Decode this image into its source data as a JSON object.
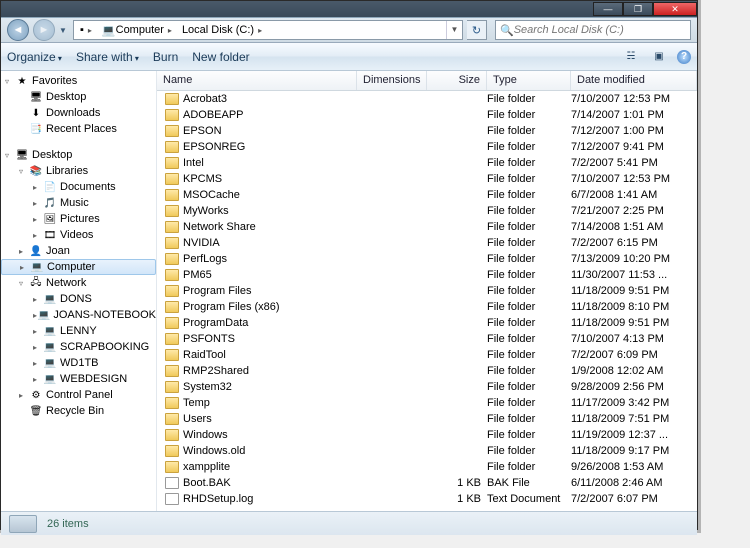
{
  "titlebar": {
    "min": "—",
    "max": "❐",
    "close": "✕"
  },
  "nav": {
    "back": "◄",
    "fwd": "►",
    "path": [
      {
        "icon": "💻",
        "label": "Computer"
      },
      {
        "icon": "",
        "label": "Local Disk (C:)"
      }
    ],
    "refresh": "↻"
  },
  "search": {
    "placeholder": "Search Local Disk (C:)"
  },
  "toolbar": {
    "organize": "Organize",
    "share": "Share with",
    "burn": "Burn",
    "newfolder": "New folder",
    "views": "☵",
    "preview": "▣",
    "help": "?"
  },
  "columns": {
    "name": "Name",
    "dim": "Dimensions",
    "size": "Size",
    "type": "Type",
    "date": "Date modified"
  },
  "tree": {
    "favorites": {
      "label": "Favorites",
      "icon": "★",
      "exp": "▿"
    },
    "fav_items": [
      {
        "label": "Desktop",
        "icon": "🖥"
      },
      {
        "label": "Downloads",
        "icon": "⬇"
      },
      {
        "label": "Recent Places",
        "icon": "📑"
      }
    ],
    "desktop": {
      "label": "Desktop",
      "icon": "🖥",
      "exp": "▿"
    },
    "libraries": {
      "label": "Libraries",
      "icon": "📚",
      "exp": "▿"
    },
    "lib_items": [
      {
        "label": "Documents",
        "icon": "📄"
      },
      {
        "label": "Music",
        "icon": "🎵"
      },
      {
        "label": "Pictures",
        "icon": "🖼"
      },
      {
        "label": "Videos",
        "icon": "🎞"
      }
    ],
    "joan": {
      "label": "Joan",
      "icon": "👤",
      "exp": "▸"
    },
    "computer": {
      "label": "Computer",
      "icon": "💻",
      "exp": "▸"
    },
    "network": {
      "label": "Network",
      "icon": "🖧",
      "exp": "▿"
    },
    "net_items": [
      {
        "label": "DONS",
        "icon": "💻"
      },
      {
        "label": "JOANS-NOTEBOOK",
        "icon": "💻"
      },
      {
        "label": "LENNY",
        "icon": "💻"
      },
      {
        "label": "SCRAPBOOKING",
        "icon": "💻"
      },
      {
        "label": "WD1TB",
        "icon": "💻"
      },
      {
        "label": "WEBDESIGN",
        "icon": "💻"
      }
    ],
    "cpanel": {
      "label": "Control Panel",
      "icon": "⚙",
      "exp": "▸"
    },
    "recycle": {
      "label": "Recycle Bin",
      "icon": "🗑",
      "exp": ""
    }
  },
  "files": [
    {
      "name": "Acrobat3",
      "size": "",
      "type": "File folder",
      "date": "7/10/2007 12:53 PM",
      "k": "folder"
    },
    {
      "name": "ADOBEAPP",
      "size": "",
      "type": "File folder",
      "date": "7/14/2007 1:01 PM",
      "k": "folder"
    },
    {
      "name": "EPSON",
      "size": "",
      "type": "File folder",
      "date": "7/12/2007 1:00 PM",
      "k": "folder"
    },
    {
      "name": "EPSONREG",
      "size": "",
      "type": "File folder",
      "date": "7/12/2007 9:41 PM",
      "k": "folder"
    },
    {
      "name": "Intel",
      "size": "",
      "type": "File folder",
      "date": "7/2/2007 5:41 PM",
      "k": "folder"
    },
    {
      "name": "KPCMS",
      "size": "",
      "type": "File folder",
      "date": "7/10/2007 12:53 PM",
      "k": "folder"
    },
    {
      "name": "MSOCache",
      "size": "",
      "type": "File folder",
      "date": "6/7/2008 1:41 AM",
      "k": "folder"
    },
    {
      "name": "MyWorks",
      "size": "",
      "type": "File folder",
      "date": "7/21/2007 2:25 PM",
      "k": "folder"
    },
    {
      "name": "Network Share",
      "size": "",
      "type": "File folder",
      "date": "7/14/2008 1:51 AM",
      "k": "folder"
    },
    {
      "name": "NVIDIA",
      "size": "",
      "type": "File folder",
      "date": "7/2/2007 6:15 PM",
      "k": "folder"
    },
    {
      "name": "PerfLogs",
      "size": "",
      "type": "File folder",
      "date": "7/13/2009 10:20 PM",
      "k": "folder"
    },
    {
      "name": "PM65",
      "size": "",
      "type": "File folder",
      "date": "11/30/2007 11:53 ...",
      "k": "folder"
    },
    {
      "name": "Program Files",
      "size": "",
      "type": "File folder",
      "date": "11/18/2009 9:51 PM",
      "k": "folder"
    },
    {
      "name": "Program Files (x86)",
      "size": "",
      "type": "File folder",
      "date": "11/18/2009 8:10 PM",
      "k": "folder"
    },
    {
      "name": "ProgramData",
      "size": "",
      "type": "File folder",
      "date": "11/18/2009 9:51 PM",
      "k": "folder"
    },
    {
      "name": "PSFONTS",
      "size": "",
      "type": "File folder",
      "date": "7/10/2007 4:13 PM",
      "k": "folder"
    },
    {
      "name": "RaidTool",
      "size": "",
      "type": "File folder",
      "date": "7/2/2007 6:09 PM",
      "k": "folder"
    },
    {
      "name": "RMP2Shared",
      "size": "",
      "type": "File folder",
      "date": "1/9/2008 12:02 AM",
      "k": "folder"
    },
    {
      "name": "System32",
      "size": "",
      "type": "File folder",
      "date": "9/28/2009 2:56 PM",
      "k": "folder"
    },
    {
      "name": "Temp",
      "size": "",
      "type": "File folder",
      "date": "11/17/2009 3:42 PM",
      "k": "folder"
    },
    {
      "name": "Users",
      "size": "",
      "type": "File folder",
      "date": "11/18/2009 7:51 PM",
      "k": "folder"
    },
    {
      "name": "Windows",
      "size": "",
      "type": "File folder",
      "date": "11/19/2009 12:37 ...",
      "k": "folder"
    },
    {
      "name": "Windows.old",
      "size": "",
      "type": "File folder",
      "date": "11/18/2009 9:17 PM",
      "k": "folder"
    },
    {
      "name": "xampplite",
      "size": "",
      "type": "File folder",
      "date": "9/26/2008 1:53 AM",
      "k": "folder"
    },
    {
      "name": "Boot.BAK",
      "size": "1 KB",
      "type": "BAK File",
      "date": "6/11/2008 2:46 AM",
      "k": "file"
    },
    {
      "name": "RHDSetup.log",
      "size": "1 KB",
      "type": "Text Document",
      "date": "7/2/2007 6:07 PM",
      "k": "file"
    }
  ],
  "status": {
    "count": "26 items"
  }
}
